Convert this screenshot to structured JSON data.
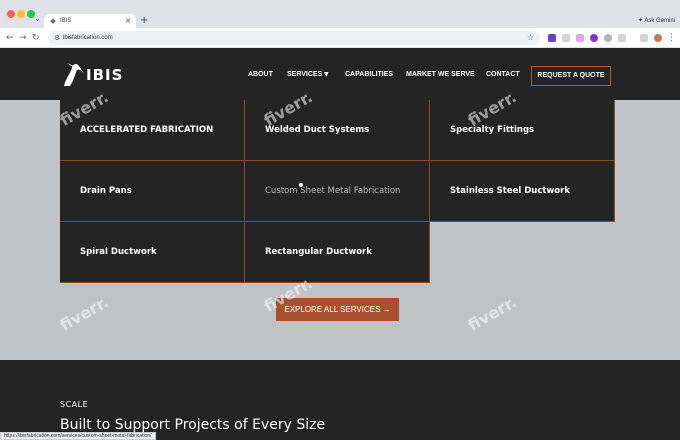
{
  "browser": {
    "tab_title": "IBIS",
    "ask_gemini": "Ask Gemini",
    "url": "ibisfabrication.com",
    "status_url": "https://ibisfabrication.com/services/custom-sheet-metal-fabrication/"
  },
  "site": {
    "logo_text": "IBIS",
    "nav": {
      "about": "ABOUT",
      "services": "SERVICES",
      "capabilities": "CAPABILITIES",
      "market": "MARKET WE SERVE",
      "contact": "CONTACT",
      "quote": "REQUEST A QUOTE"
    },
    "services_menu": [
      "ACCELERATED FABRICATION",
      "Welded Duct Systems",
      "Specialty Fittings",
      "Drain Pans",
      "Custom Sheet Metal Fabrication",
      "Stainless Steel Ductwork",
      "Spiral Ductwork",
      "Rectangular Ductwork"
    ],
    "explore_button": "EXPLORE ALL SERVICES →",
    "scale_label": "SCALE",
    "scale_title": "Built to Support Projects of Every Size"
  },
  "watermark": "fiverr.",
  "colors": {
    "header_bg": "#242424",
    "accent": "#a9502e",
    "page_bg": "#bfc3c6"
  }
}
